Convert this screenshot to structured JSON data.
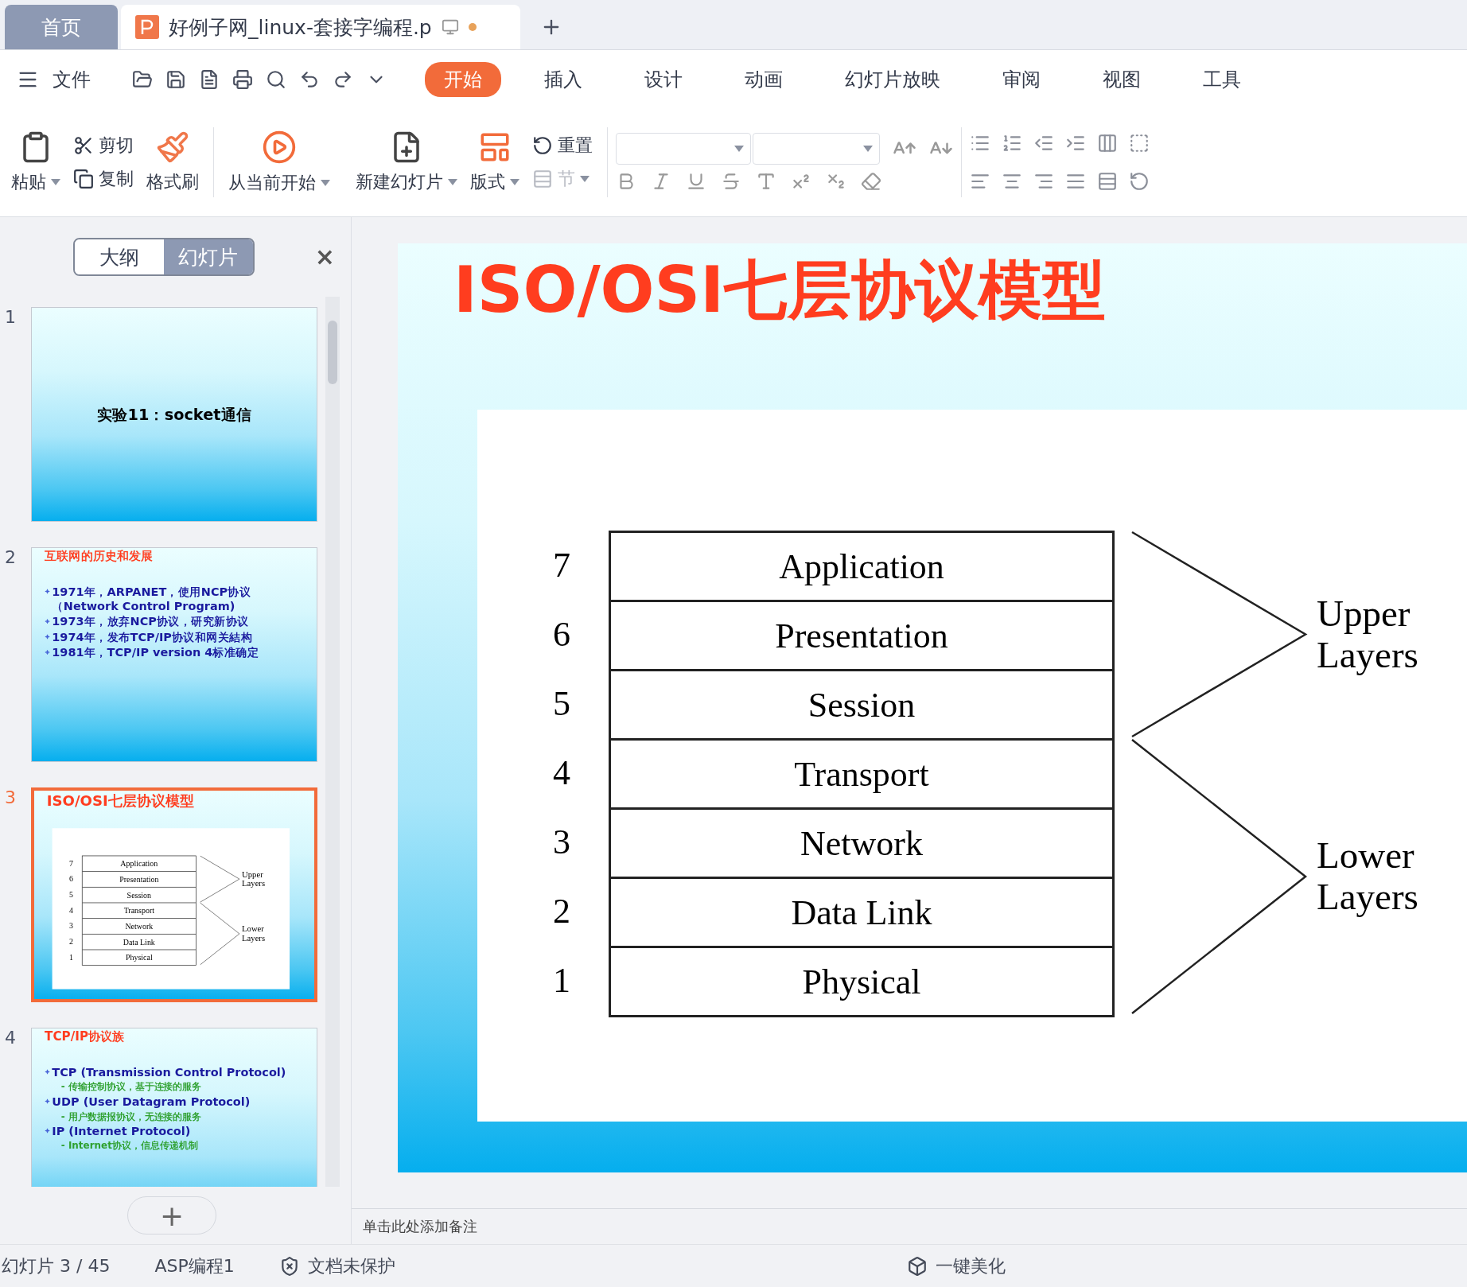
{
  "tabs": [
    {
      "label": "首页",
      "kind": "home",
      "selected": false
    },
    {
      "label": "好例子网_linux-套接字编程.p",
      "kind": "document",
      "selected": true,
      "modified": true
    }
  ],
  "menu": {
    "file": "文件",
    "ribbon_tabs": [
      {
        "label": "开始",
        "selected": true
      },
      {
        "label": "插入",
        "selected": false
      },
      {
        "label": "设计",
        "selected": false
      },
      {
        "label": "动画",
        "selected": false
      },
      {
        "label": "幻灯片放映",
        "selected": false
      },
      {
        "label": "审阅",
        "selected": false
      },
      {
        "label": "视图",
        "selected": false
      },
      {
        "label": "工具",
        "selected": false
      }
    ]
  },
  "ribbon": {
    "paste": {
      "label": "粘贴"
    },
    "cut": {
      "label": "剪切"
    },
    "copy": {
      "label": "复制"
    },
    "format_painter": {
      "label": "格式刷"
    },
    "play_from_current": {
      "label": "从当前开始"
    },
    "new_slide": {
      "label": "新建幻灯片"
    },
    "layout": {
      "label": "版式"
    },
    "reset": {
      "label": "重置",
      "disabled": false
    },
    "section": {
      "label": "节",
      "disabled": true
    }
  },
  "panel": {
    "view_tabs": [
      {
        "label": "大纲",
        "selected": false
      },
      {
        "label": "幻灯片",
        "selected": true
      }
    ],
    "close": "×",
    "add": "+",
    "slides": [
      {
        "number": "1",
        "selected": false,
        "kind": "title",
        "title": "实验11：socket通信"
      },
      {
        "number": "2",
        "selected": false,
        "kind": "bullets",
        "title": "互联网的历史和发展",
        "bullets": [
          {
            "text": "1971年，ARPANET，使用NCP协议（Network Control Program)"
          },
          {
            "text": "1973年，放弃NCP协议，研究新协议"
          },
          {
            "text": "1974年，发布TCP/IP协议和网关結构"
          },
          {
            "text": "1981年，TCP/IP version 4标准确定"
          }
        ]
      },
      {
        "number": "3",
        "selected": true,
        "kind": "diagram",
        "title": "ISO/OSI七层协议模型",
        "groups": [
          {
            "label": "Upper Layers",
            "layers": [
              {
                "number": "7",
                "name": "Application"
              },
              {
                "number": "6",
                "name": "Presentation"
              },
              {
                "number": "5",
                "name": "Session"
              }
            ]
          },
          {
            "label": "Lower Layers",
            "layers": [
              {
                "number": "4",
                "name": "Transport"
              },
              {
                "number": "3",
                "name": "Network"
              },
              {
                "number": "2",
                "name": "Data Link"
              },
              {
                "number": "1",
                "name": "Physical"
              }
            ]
          }
        ]
      },
      {
        "number": "4",
        "selected": false,
        "kind": "bullets",
        "title": "TCP/IP协议族",
        "bullets": [
          {
            "text": "TCP (Transmission Control Protocol)",
            "children": [
              {
                "text": "- 传输控制协议，基于连接的服务"
              }
            ]
          },
          {
            "text": "UDP (User Datagram Protocol)",
            "children": [
              {
                "text": "- 用户数据报协议，无连接的服务"
              }
            ]
          },
          {
            "text": "IP (Internet Protocol)",
            "children": [
              {
                "text": "- Internet协议，信息传递机制"
              }
            ]
          }
        ]
      }
    ]
  },
  "current_slide": {
    "kind": "diagram",
    "title": "ISO/OSI七层协议模型",
    "groups": [
      {
        "label": "Upper Layers",
        "layers": [
          {
            "number": "7",
            "name": "Application"
          },
          {
            "number": "6",
            "name": "Presentation"
          },
          {
            "number": "5",
            "name": "Session"
          }
        ]
      },
      {
        "label": "Lower Layers",
        "layers": [
          {
            "number": "4",
            "name": "Transport"
          },
          {
            "number": "3",
            "name": "Network"
          },
          {
            "number": "2",
            "name": "Data Link"
          },
          {
            "number": "1",
            "name": "Physical"
          }
        ]
      }
    ]
  },
  "notes": {
    "placeholder": "单击此处添加备注"
  },
  "status_bar": {
    "slide_counter": "幻灯片 3 / 45",
    "theme": "ASP编程1",
    "protection": "文档未保护",
    "beautify": "一键美化"
  }
}
